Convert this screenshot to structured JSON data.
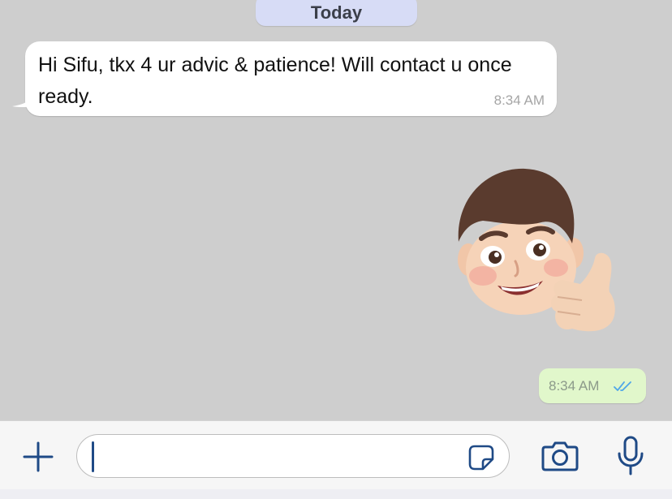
{
  "chat": {
    "date_label": "Today",
    "messages": [
      {
        "direction": "incoming",
        "text": "Hi Sifu, tkx 4 ur advic & patience! Will contact u once ready.",
        "time": "8:34 AM"
      },
      {
        "direction": "outgoing",
        "type": "sticker",
        "sticker": "memoji-thumbs-up",
        "time": "8:34 AM",
        "status": "read"
      }
    ]
  },
  "composer": {
    "value": "",
    "icons": {
      "add": "plus-icon",
      "sticker": "sticker-icon",
      "camera": "camera-icon",
      "microphone": "microphone-icon"
    }
  },
  "colors": {
    "chat_background": "#cecece",
    "incoming_bubble": "#ffffff",
    "outgoing_bubble": "#e1f7cb",
    "date_pill": "#d7dcf6",
    "icon_blue": "#1f4a86",
    "read_ticks": "#4fa6e9"
  }
}
